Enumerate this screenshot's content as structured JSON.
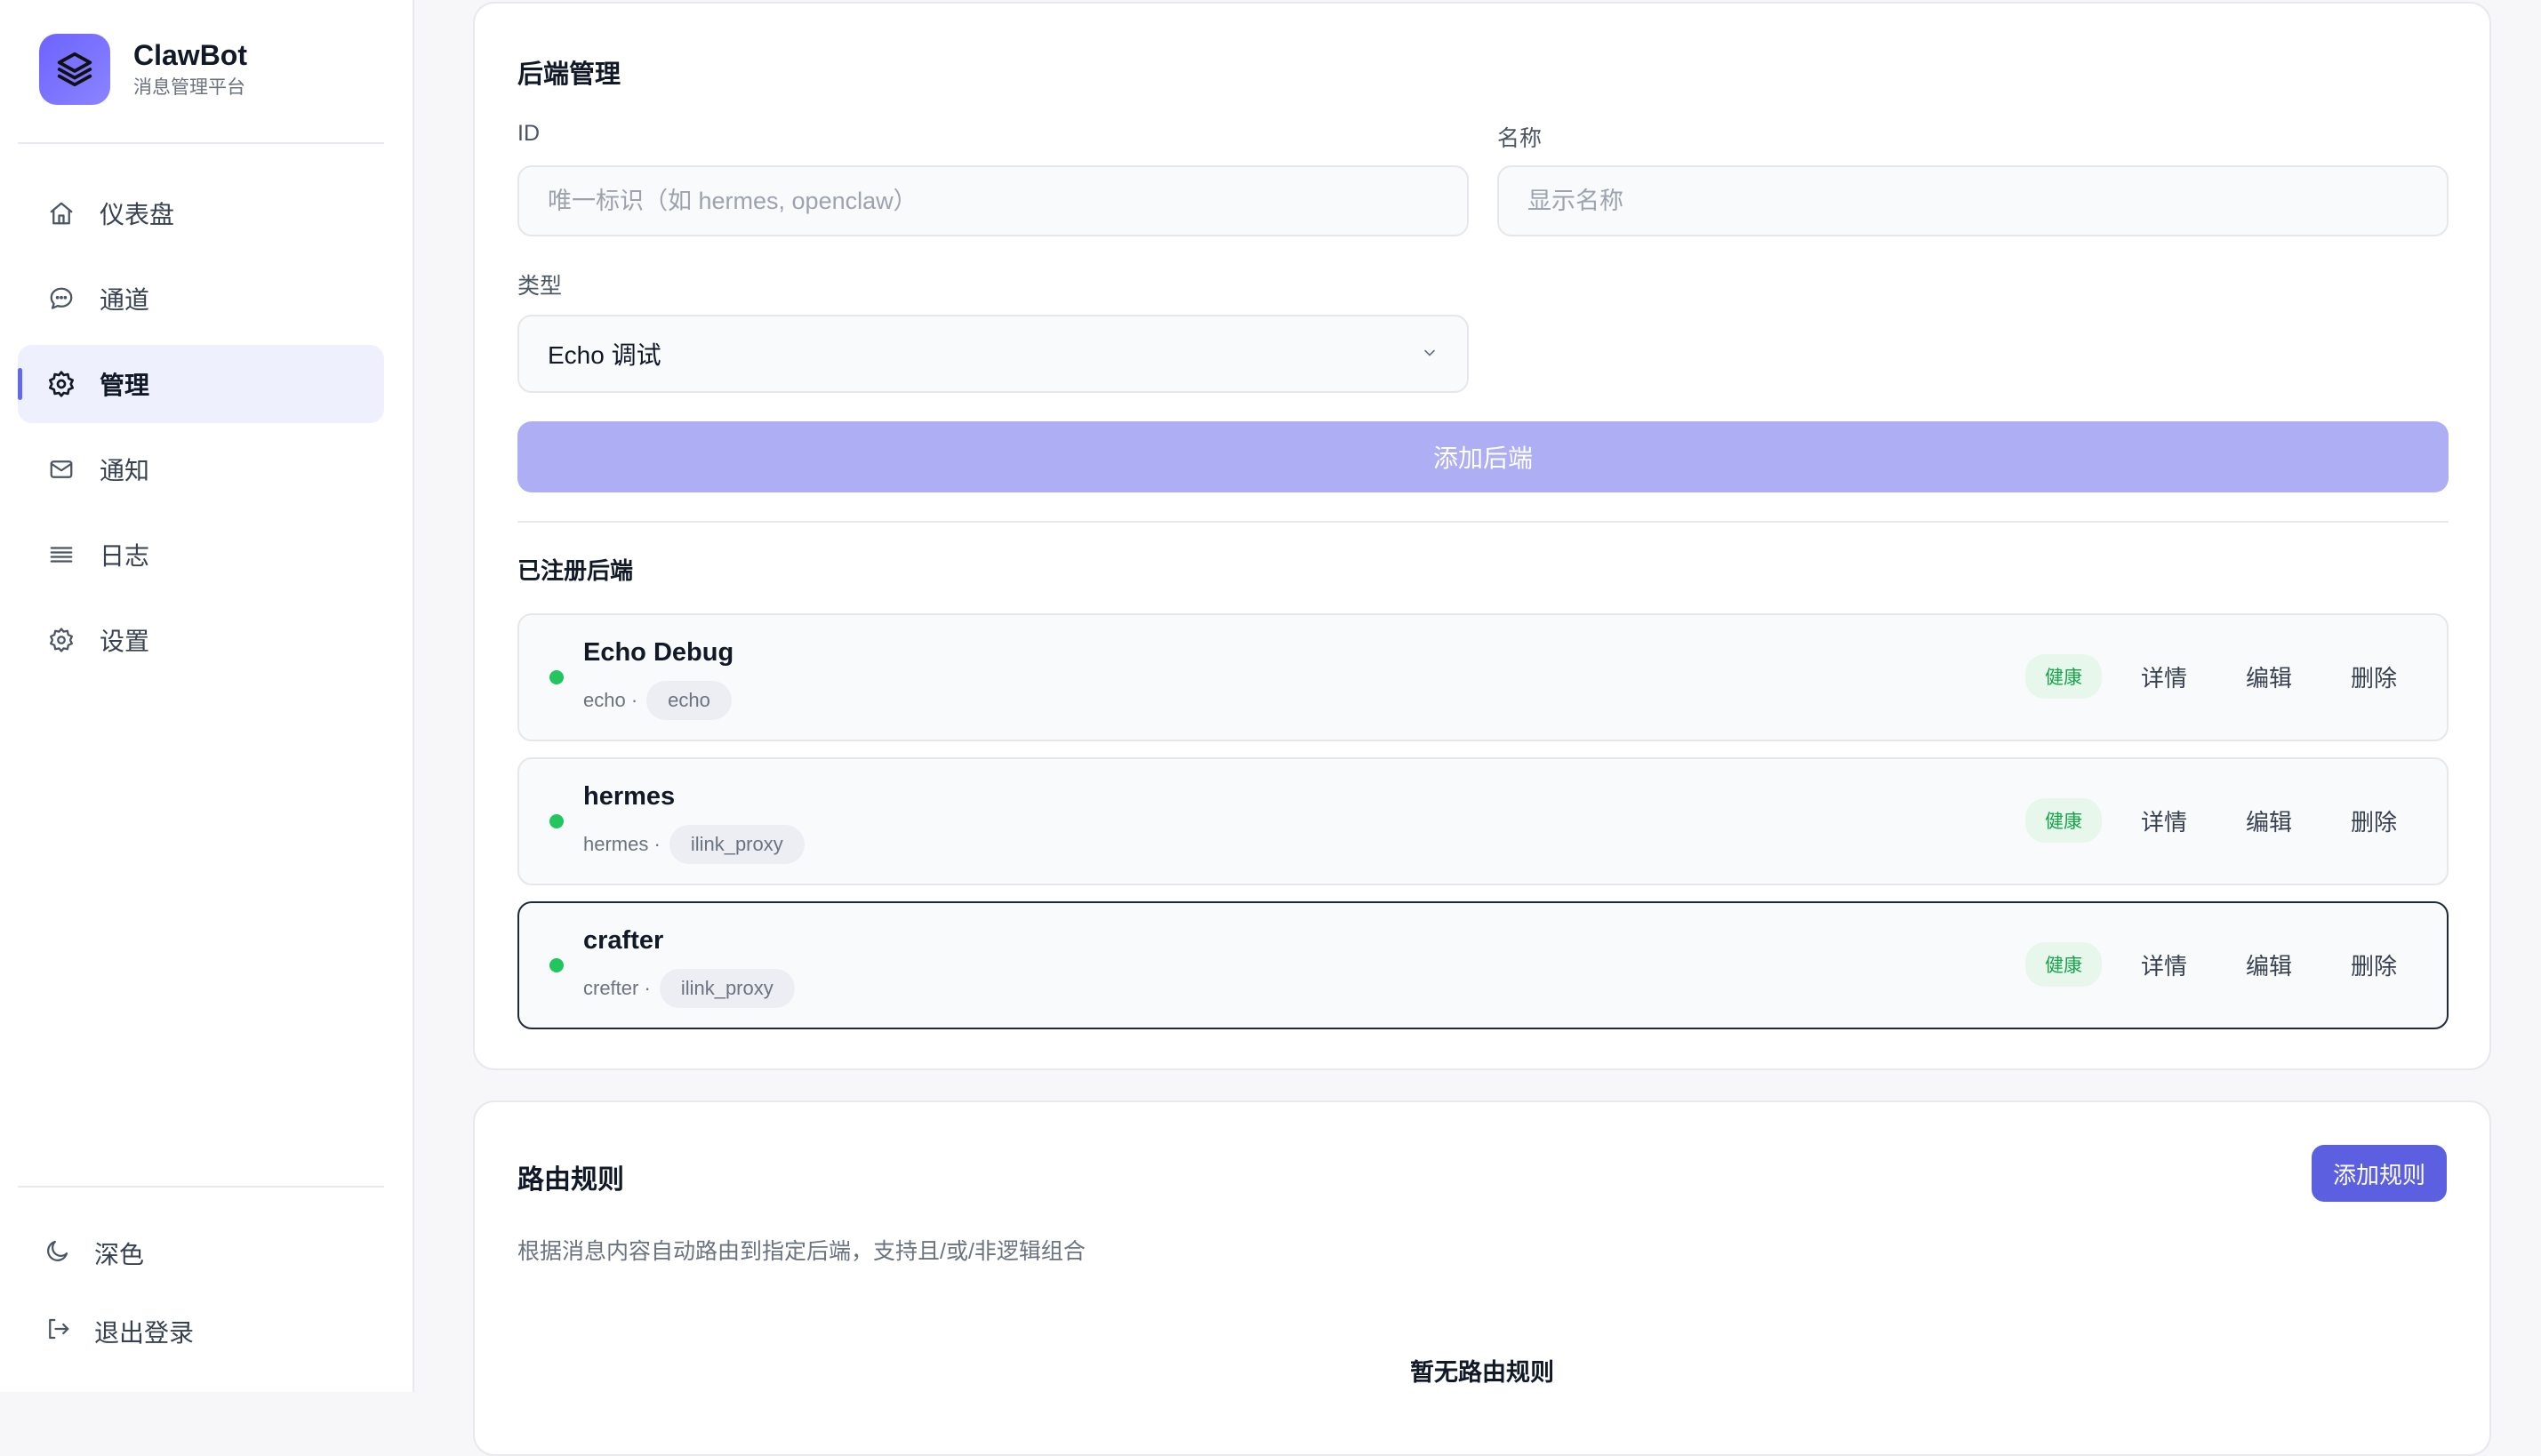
{
  "brand": {
    "name": "ClawBot",
    "subtitle": "消息管理平台"
  },
  "sidebar": {
    "items": [
      {
        "label": "仪表盘",
        "icon": "home-icon",
        "active": false
      },
      {
        "label": "通道",
        "icon": "chat-bubble-icon",
        "active": false
      },
      {
        "label": "管理",
        "icon": "gear-icon",
        "active": true
      },
      {
        "label": "通知",
        "icon": "mail-icon",
        "active": false
      },
      {
        "label": "日志",
        "icon": "list-icon",
        "active": false
      },
      {
        "label": "设置",
        "icon": "gear-icon",
        "active": false
      }
    ],
    "bottom": [
      {
        "label": "深色",
        "icon": "moon-icon"
      },
      {
        "label": "退出登录",
        "icon": "logout-icon"
      }
    ]
  },
  "backend_mgmt": {
    "title": "后端管理",
    "id_label": "ID",
    "id_placeholder": "唯一标识（如 hermes, openclaw）",
    "name_label": "名称",
    "name_placeholder": "显示名称",
    "type_label": "类型",
    "type_value": "Echo 调试",
    "add_button": "添加后端",
    "registered_title": "已注册后端",
    "backends": [
      {
        "name": "Echo Debug",
        "id": "echo",
        "type": "echo",
        "status": "健康"
      },
      {
        "name": "hermes",
        "id": "hermes",
        "type": "ilink_proxy",
        "status": "健康"
      },
      {
        "name": "crafter",
        "id": "crefter",
        "type": "ilink_proxy",
        "status": "健康"
      }
    ],
    "actions": {
      "detail": "详情",
      "edit": "编辑",
      "delete": "删除"
    }
  },
  "routing": {
    "title": "路由规则",
    "add_button": "添加规则",
    "description": "根据消息内容自动路由到指定后端，支持且/或/非逻辑组合",
    "empty": "暂无路由规则"
  },
  "colors": {
    "accent": "#6366f1",
    "accent_light": "#adaef3",
    "healthy": "#22c55e"
  }
}
